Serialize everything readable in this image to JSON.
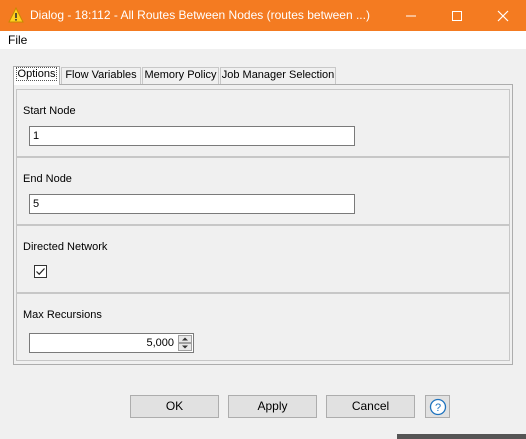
{
  "window": {
    "title": "Dialog - 18:112 - All Routes Between Nodes (routes between ...)"
  },
  "menu": {
    "file": "File"
  },
  "tabs": [
    {
      "label": "Options",
      "active": true
    },
    {
      "label": "Flow Variables"
    },
    {
      "label": "Memory Policy"
    },
    {
      "label": "Job Manager Selection"
    }
  ],
  "options": {
    "start_node": {
      "label": "Start Node",
      "value": "1"
    },
    "end_node": {
      "label": "End Node",
      "value": "5"
    },
    "directed": {
      "label": "Directed Network",
      "checked": true
    },
    "max_recursions": {
      "label": "Max Recursions",
      "value": "5,000"
    }
  },
  "buttons": {
    "ok": "OK",
    "apply": "Apply",
    "cancel": "Cancel"
  },
  "colors": {
    "titlebar": "#f47b21",
    "help": "#1e73be"
  },
  "icons": {
    "app": "warning-triangle-icon",
    "minimize": "minimize-icon",
    "maximize": "maximize-icon",
    "close": "close-icon",
    "help": "help-question-icon",
    "checkbox": "checkmark-icon"
  }
}
